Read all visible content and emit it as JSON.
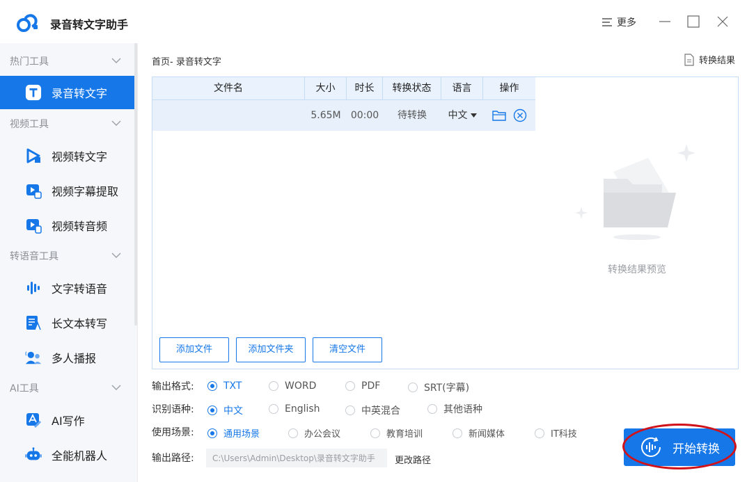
{
  "app": {
    "title": "录音转文字助手",
    "more_label": "更多",
    "accent_color": "#1677e8"
  },
  "sidebar": {
    "groups": [
      {
        "label": "热门工具",
        "items": [
          {
            "label": "录音转文字",
            "icon": "mic-text-icon",
            "active": true
          }
        ]
      },
      {
        "label": "视频工具",
        "items": [
          {
            "label": "视频转文字",
            "icon": "video-text-icon"
          },
          {
            "label": "视频字幕提取",
            "icon": "subtitle-extract-icon"
          },
          {
            "label": "视频转音频",
            "icon": "video-audio-icon"
          }
        ]
      },
      {
        "label": "转语音工具",
        "items": [
          {
            "label": "文字转语音",
            "icon": "text-speech-icon"
          },
          {
            "label": "长文本转写",
            "icon": "long-text-icon"
          },
          {
            "label": "多人播报",
            "icon": "multi-speaker-icon"
          }
        ]
      },
      {
        "label": "AI工具",
        "items": [
          {
            "label": "AI写作",
            "icon": "ai-writing-icon"
          },
          {
            "label": "全能机器人",
            "icon": "robot-icon"
          }
        ]
      }
    ]
  },
  "main": {
    "breadcrumb": "首页- 录音转文字",
    "result_link": "转换结果",
    "table": {
      "headers": [
        "文件名",
        "大小",
        "时长",
        "转换状态",
        "语言",
        "操作"
      ],
      "rows": [
        {
          "name": "",
          "size": "5.65M",
          "duration": "00:00",
          "status": "待转换",
          "language": "中文"
        }
      ]
    },
    "buttons": {
      "add_file": "添加文件",
      "add_folder": "添加文件夹",
      "clear_files": "清空文件"
    },
    "preview_text": "转换结果预览"
  },
  "options": {
    "format": {
      "label": "输出格式:",
      "choices": [
        "TXT",
        "WORD",
        "PDF",
        "SRT(字幕)"
      ],
      "selected": "TXT"
    },
    "language": {
      "label": "识别语种:",
      "choices": [
        "中文",
        "English",
        "中英混合",
        "其他语种"
      ],
      "selected": "中文"
    },
    "scene": {
      "label": "使用场景:",
      "choices": [
        "通用场景",
        "办公会议",
        "教育培训",
        "新闻媒体",
        "IT科技"
      ],
      "selected": "通用场景"
    },
    "path": {
      "label": "输出路径:",
      "value": "C:\\Users\\Admin\\Desktop\\录音转文字助手",
      "change_label": "更改路径"
    }
  },
  "start_button": {
    "label": "开始转换"
  }
}
